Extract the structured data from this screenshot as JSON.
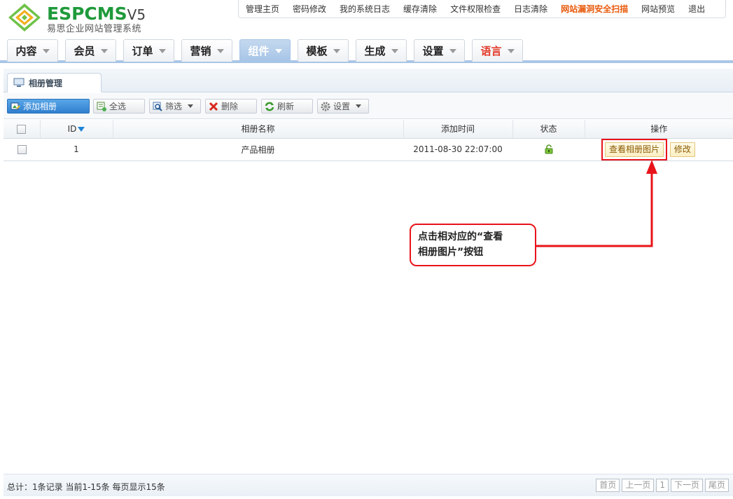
{
  "logo": {
    "brand": "ESPCMS",
    "version": "V5",
    "subtitle": "易思企业网站管理系统"
  },
  "topnav": [
    {
      "label": "管理主页"
    },
    {
      "label": "密码修改"
    },
    {
      "label": "我的系统日志"
    },
    {
      "label": "缓存清除"
    },
    {
      "label": "文件权限检查"
    },
    {
      "label": "日志清除"
    },
    {
      "label": "网站漏洞安全扫描"
    },
    {
      "label": "网站预览"
    },
    {
      "label": "退出"
    }
  ],
  "mainmenu": [
    {
      "label": "内容"
    },
    {
      "label": "会员"
    },
    {
      "label": "订单"
    },
    {
      "label": "营销"
    },
    {
      "label": "组件"
    },
    {
      "label": "模板"
    },
    {
      "label": "生成"
    },
    {
      "label": "设置"
    },
    {
      "label": "语言"
    }
  ],
  "panel": {
    "tab_label": "相册管理"
  },
  "toolbar": {
    "add": "添加相册",
    "select_all": "全选",
    "filter": "筛选",
    "delete": "删除",
    "refresh": "刷新",
    "settings": "设置"
  },
  "table": {
    "headers": {
      "id": "ID",
      "name": "相册名称",
      "time": "添加时间",
      "status": "状态",
      "ops": "操作"
    },
    "rows": [
      {
        "id": "1",
        "name": "产品相册",
        "time": "2011-08-30 22:07:00",
        "view_label": "查看相册图片",
        "edit_label": "修改"
      }
    ]
  },
  "callout": {
    "line1": "点击相对应的“查看",
    "line2": "相册图片”按钮"
  },
  "footer": {
    "info": "总计：1条记录 当前1-15条 每页显示15条",
    "pager": {
      "first": "首页",
      "prev": "上一页",
      "page": "1",
      "next": "下一页",
      "last": "尾页"
    }
  },
  "colors": {
    "accent": "#2f7fcf",
    "highlight": "#e8141a",
    "hot_link": "#e85a0c",
    "brand_green": "#1f9a3a"
  }
}
